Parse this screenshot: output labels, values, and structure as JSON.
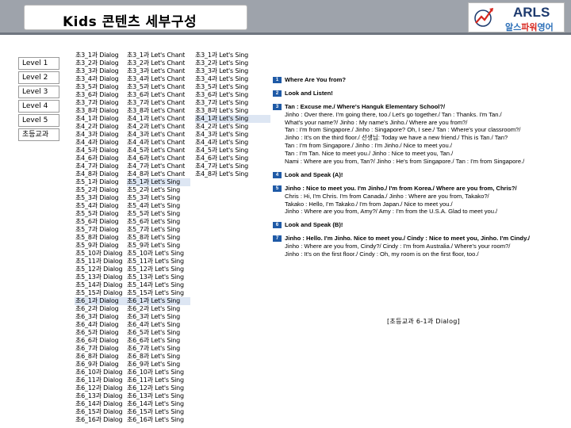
{
  "header": {
    "title": "Kids 콘텐츠 세부구성",
    "logo_text": "ARLS",
    "logo_sub_a": "알스",
    "logo_sub_b": "파워",
    "logo_sub_c": "영어"
  },
  "levels": [
    "Level 1",
    "Level 2",
    "Level 3",
    "Level 4",
    "Level 5",
    "초등교과"
  ],
  "column1": [
    "초3_1과 Dialog",
    "초3_2과 Dialog",
    "초3_3과 Dialog",
    "초3_4과 Dialog",
    "초3_5과 Dialog",
    "초3_6과 Dialog",
    "초3_7과 Dialog",
    "초3_8과 Dialog",
    "초4_1과 Dialog",
    "초4_2과 Dialog",
    "초4_3과 Dialog",
    "초4_4과 Dialog",
    "초4_5과 Dialog",
    "초4_6과 Dialog",
    "초4_7과 Dialog",
    "초4_8과 Dialog",
    "초5_1과 Dialog",
    "초5_2과 Dialog",
    "초5_3과 Dialog",
    "초5_4과 Dialog",
    "초5_5과 Dialog",
    "초5_6과 Dialog",
    "초5_7과 Dialog",
    "초5_8과 Dialog",
    "초5_9과 Dialog",
    "초5_10과 Dialog",
    "초5_11과 Dialog",
    "초5_12과 Dialog",
    "초5_13과 Dialog",
    "초5_14과 Dialog",
    "초5_15과 Dialog",
    "초6_1과 Dialog",
    "초6_2과 Dialog",
    "초6_3과 Dialog",
    "초6_4과 Dialog",
    "초6_5과 Dialog",
    "초6_6과 Dialog",
    "초6_7과 Dialog",
    "초6_8과 Dialog",
    "초6_9과 Dialog",
    "초6_10과 Dialog",
    "초6_11과 Dialog",
    "초6_12과 Dialog",
    "초6_13과 Dialog",
    "초6_14과 Dialog",
    "초6_15과 Dialog",
    "초6_16과 Dialog"
  ],
  "column2": [
    "초3_1과 Let's Chant",
    "초3_2과 Let's Chant",
    "초3_3과 Let's Chant",
    "초3_4과 Let's Chant",
    "초3_5과 Let's Chant",
    "초3_6과 Let's Chant",
    "초3_7과 Let's Chant",
    "초3_8과 Let's Chant",
    "초4_1과 Let's Chant",
    "초4_2과 Let's Chant",
    "초4_3과 Let's Chant",
    "초4_4과 Let's Chant",
    "초4_5과 Let's Chant",
    "초4_6과 Let's Chant",
    "초4_7과 Let's Chant",
    "초4_8과 Let's Chant",
    "초5_1과 Let's Sing",
    "초5_2과 Let's Sing",
    "초5_3과 Let's Sing",
    "초5_4과 Let's Sing",
    "초5_5과 Let's Sing",
    "초5_6과 Let's Sing",
    "초5_7과 Let's Sing",
    "초5_8과 Let's Sing",
    "초5_9과 Let's Sing",
    "초5_10과 Let's Sing",
    "초5_11과 Let's Sing",
    "초5_12과 Let's Sing",
    "초5_13과 Let's Sing",
    "초5_14과 Let's Sing",
    "초5_15과 Let's Sing",
    "초6_1과 Let's Sing",
    "초6_2과 Let's Sing",
    "초6_3과 Let's Sing",
    "초6_4과 Let's Sing",
    "초6_5과 Let's Sing",
    "초6_6과 Let's Sing",
    "초6_7과 Let's Sing",
    "초6_8과 Let's Sing",
    "초6_9과 Let's Sing",
    "초6_10과 Let's Sing",
    "초6_11과 Let's Sing",
    "초6_12과 Let's Sing",
    "초6_13과 Let's Sing",
    "초6_14과 Let's Sing",
    "초6_15과 Let's Sing",
    "초6_16과 Let's Sing"
  ],
  "column3": [
    "초3_1과 Let's Sing",
    "초3_2과 Let's Sing",
    "초3_3과 Let's Sing",
    "초3_4과 Let's Sing",
    "초3_5과 Let's Sing",
    "초3_6과 Let's Sing",
    "초3_7과 Let's Sing",
    "초3_8과 Let's Sing",
    "초4_1과 Let's Sing",
    "초4_2과 Let's Sing",
    "초4_3과 Let's Sing",
    "초4_4과 Let's Sing",
    "초4_5과 Let's Sing",
    "초4_6과 Let's Sing",
    "초4_7과 Let's Sing",
    "초4_8과 Let's Sing"
  ],
  "content": {
    "sections": [
      {
        "num": "1",
        "head": "Where Are You from?",
        "lines": []
      },
      {
        "num": "2",
        "head": "Look and Listen!",
        "lines": []
      },
      {
        "num": "3",
        "head": "Tan : Excuse me./ Where's Hanguk Elementary School?/",
        "lines": [
          "Jinho : Over there. I'm going there, too./ Let's go together./ Tan : Thanks. I'm Tan./",
          "What's your name?/ Jinho : My name's Jinho./ Where are you from?/",
          "Tan : I'm from Singapore./ Jinho : Singapore? Oh, I see./ Tan : Where's your classroom?/",
          "Jinho : It's on the third floor./ 선생님: Today we have a new friend./ This is Tan./ Tan?",
          "Tan : I'm from Singapore./ Jinho : I'm Jinho./ Nice to meet you./",
          "Tan : I'm Tan. Nice to meet you./ Jinho : Nice to meet you, Tan./",
          "Nami : Where are you from, Tan?/ Jinho : He's from Singapore./ Tan : I'm from Singapore./"
        ]
      },
      {
        "num": "4",
        "head": "Look and Speak (A)!",
        "lines": []
      },
      {
        "num": "5",
        "head": "Jinho : Nice to meet you. I'm Jinho./ I'm from Korea./ Where are you from, Chris?/",
        "lines": [
          "Chris : Hi, I'm Chris. I'm from Canada./ Jinho : Where are you from, Takako?/",
          "Takako : Hello, I'm Takako./ I'm from Japan./ Nice to meet you./",
          "Jinho : Where are you from, Amy?/ Amy : I'm from the U.S.A. Glad to meet you./"
        ]
      },
      {
        "num": "6",
        "head": "Look and Speak (B)!",
        "lines": []
      },
      {
        "num": "7",
        "head": "Jinho : Hello. I'm Jinho. Nice to meet you./ Cindy : Nice to meet you, Jinho. I'm Cindy./",
        "lines": [
          "Jinho : Where are you from, Cindy?/ Cindy : I'm from Australia./ Where's your room?/",
          "Jinho : It's on the first floor./ Cindy : Oh, my room is on the first floor, too./"
        ]
      }
    ]
  },
  "caption": "[초등교과 6-1과 Dialog]",
  "colors": {
    "header_band": "#9ea3ab",
    "selected_row": "#dde6f3",
    "number_badge": "#1f5aa6",
    "logo_blue": "#1d3a6e",
    "logo_red": "#d7261e"
  }
}
